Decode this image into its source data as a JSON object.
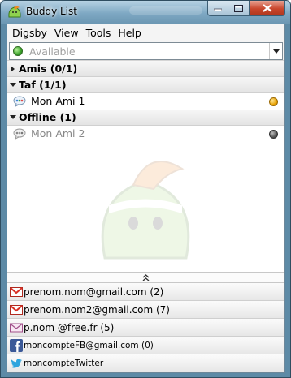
{
  "window": {
    "title": "Buddy List"
  },
  "menu": {
    "items": [
      "Digsby",
      "View",
      "Tools",
      "Help"
    ]
  },
  "status": {
    "value": "Available"
  },
  "groups": [
    {
      "label": "Amis (0/1)",
      "expanded": false,
      "buddies": []
    },
    {
      "label": "Taf (1/1)",
      "expanded": true,
      "buddies": [
        {
          "name": "Mon Ami 1",
          "state": "away"
        }
      ]
    },
    {
      "label": "Offline (1)",
      "expanded": true,
      "buddies": [
        {
          "name": "Mon Ami 2",
          "state": "offline"
        }
      ]
    }
  ],
  "accounts": [
    {
      "icon": "gmail-icon",
      "label": "prenom.nom@gmail.com (2)"
    },
    {
      "icon": "gmail-icon",
      "label": "prenom.nom2@gmail.com (7)"
    },
    {
      "icon": "email-envelope-icon",
      "label": "p.nom @free.fr (5)"
    },
    {
      "icon": "facebook-icon",
      "label": "moncompteFB@gmail.com (0)"
    },
    {
      "icon": "twitter-icon",
      "label": "moncompteTwitter"
    }
  ],
  "colors": {
    "titlebar": "#7ea8c3",
    "status_online": "#3aa22a",
    "presence_away": "#e8a100",
    "presence_offline": "#555555"
  }
}
